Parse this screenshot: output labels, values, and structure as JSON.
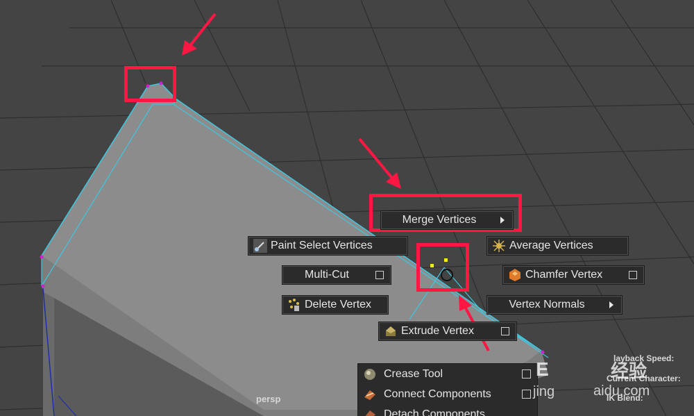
{
  "viewport": {
    "camera_label": "persp"
  },
  "marking_menu": {
    "merge_vertices": "Merge Vertices",
    "paint_select_vertices": "Paint Select Vertices",
    "average_vertices": "Average Vertices",
    "multi_cut": "Multi-Cut",
    "chamfer_vertex": "Chamfer Vertex",
    "delete_vertex": "Delete Vertex",
    "vertex_normals": "Vertex Normals",
    "extrude_vertex": "Extrude Vertex"
  },
  "context_menu": {
    "items": [
      "Crease Tool",
      "Connect Components",
      "Detach Components"
    ]
  },
  "hud": {
    "playback_speed": "layback Speed:",
    "current_character": "Current Character:",
    "ik_blend": "IK Blend:"
  },
  "watermark": {
    "brand": "经验",
    "site_partial": "jing",
    "domain": "aidu.com",
    "letter": "E"
  },
  "colors": {
    "annotation_red": "#ff1744",
    "wire_cyan": "#3ec6e0",
    "menu_bg": "#2b2b2b",
    "viewport_bg": "#444444"
  }
}
